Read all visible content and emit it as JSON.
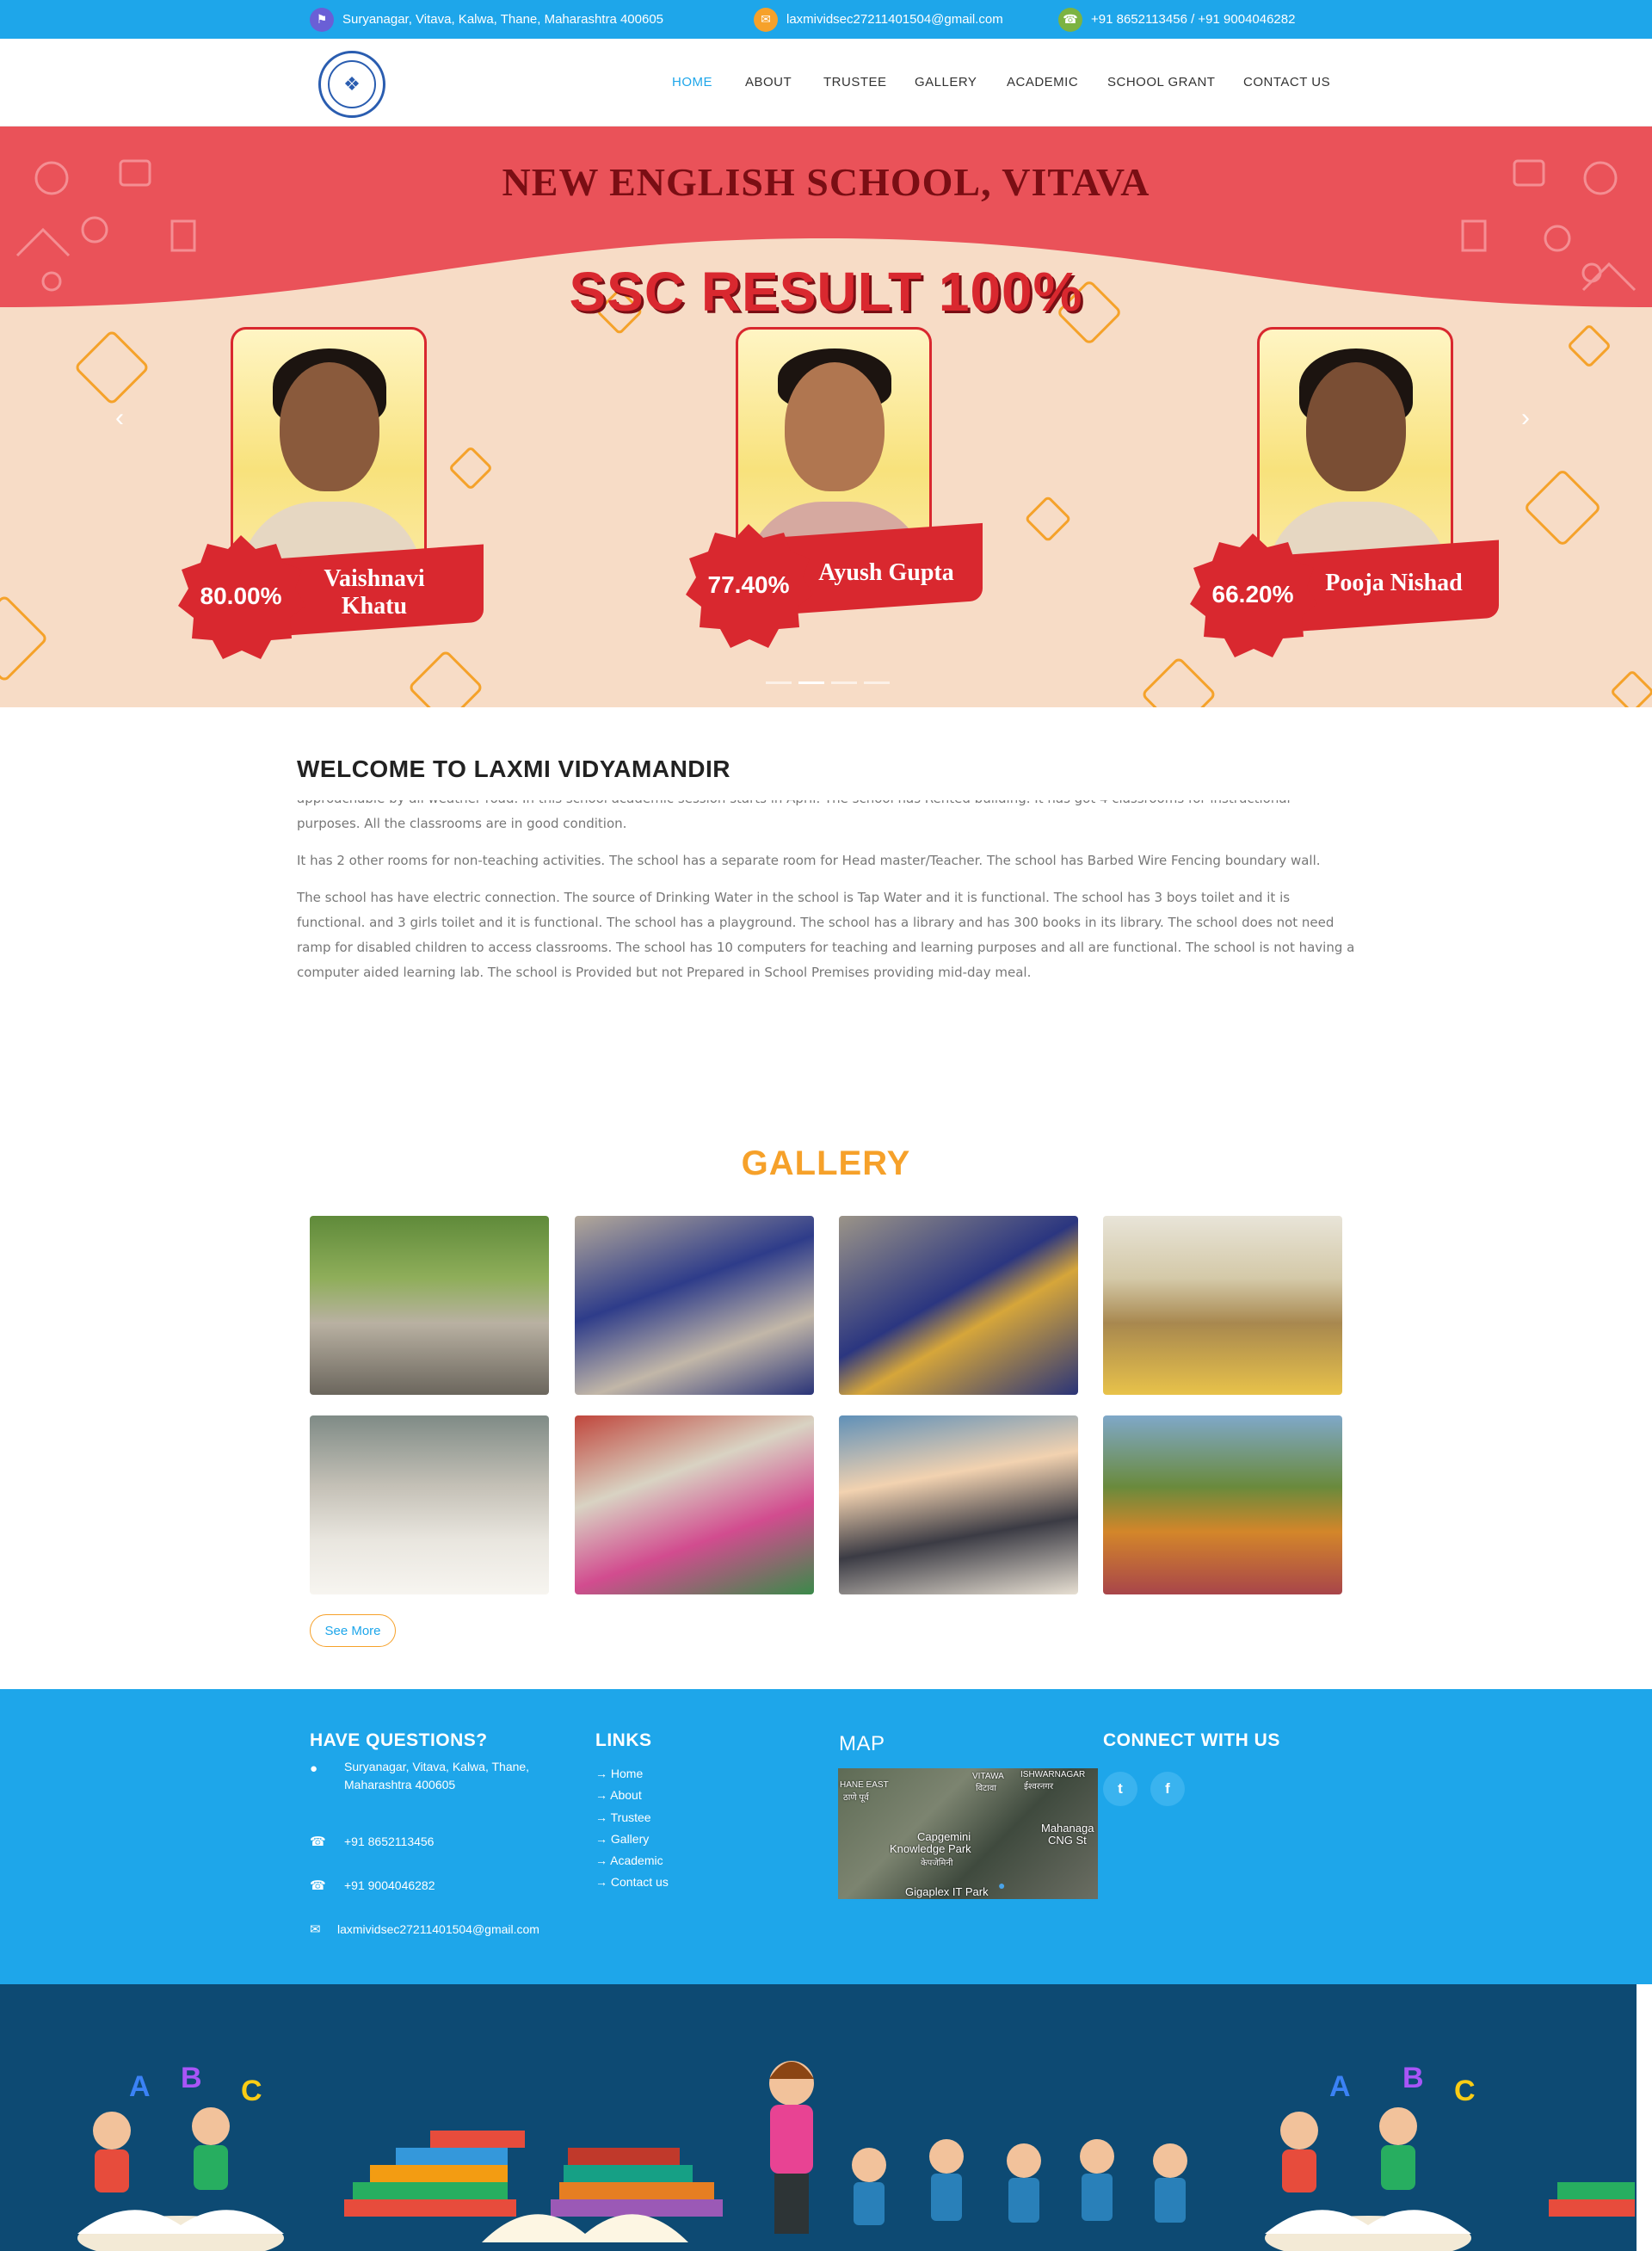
{
  "topbar": {
    "address": "Suryanagar, Vitava, Kalwa, Thane, Maharashtra 400605",
    "email": "laxmividsec27211401504@gmail.com",
    "phone": "+91 8652113456 / +91 9004046282",
    "icons": [
      "map-icon",
      "mail-icon",
      "phone-icon"
    ]
  },
  "nav": {
    "items": [
      "HOME",
      "ABOUT",
      "TRUSTEE",
      "GALLERY",
      "ACADEMIC",
      "SCHOOL GRANT",
      "CONTACT US"
    ],
    "active": "HOME"
  },
  "hero": {
    "title": "NEW ENGLISH SCHOOL, VITAVA",
    "result": "SSC RESULT 100%",
    "students": [
      {
        "percent": "80.00%",
        "name_line1": "Vaishnavi",
        "name_line2": "Khatu"
      },
      {
        "percent": "77.40%",
        "name_line1": "Ayush Gupta",
        "name_line2": ""
      },
      {
        "percent": "66.20%",
        "name_line1": "Pooja Nishad",
        "name_line2": ""
      }
    ],
    "slide_count": 4,
    "active_slide": 2
  },
  "welcome": {
    "title": "WELCOME TO LAXMI VIDYAMANDIR",
    "p1": "approachable by all weather road. In this school academic session starts in April. The school has Rented building. It has got 4 classrooms for instructional purposes. All the classrooms are in good condition.",
    "p2": "It has 2 other rooms for non-teaching activities. The school has a separate room for Head master/Teacher. The school has Barbed Wire Fencing boundary wall.",
    "p3": "The school has have electric connection. The source of Drinking Water in the school is Tap Water and it is functional. The school has 3 boys toilet and it is functional. and 3 girls toilet and it is functional. The school has a playground. The school has a library and has 300 books in its library. The school does not need ramp for disabled children to access classrooms. The school has 10 computers for teaching and learning purposes and all are functional. The school is not having a computer aided learning lab. The school is Provided but not Prepared in School Premises providing mid-day meal."
  },
  "gallery": {
    "title": "GALLERY",
    "see_more": "See More",
    "photo_count": 8
  },
  "footer": {
    "questions_title": "HAVE QUESTIONS?",
    "address_line1": "Suryanagar, Vitava, Kalwa, Thane,",
    "address_line2": "Maharashtra 400605",
    "phone1": "+91 8652113456",
    "phone2": "+91 9004046282",
    "email": "laxmividsec27211401504@gmail.com",
    "links_title": "LINKS",
    "links": [
      "Home",
      "About",
      "Trustee",
      "Gallery",
      "Academic",
      "Contact us"
    ],
    "map_title": "MAP",
    "map_labels": [
      "HANE EAST",
      "ठाणे पूर्व",
      "VITAWA",
      "विटावा",
      "ISHWARNAGAR",
      "ईश्वरनगर",
      "Capgemini",
      "Knowledge Park",
      "केपजेमिनी",
      "Mahanaga",
      "CNG St",
      "Gigaplex IT Park"
    ],
    "connect_title": "CONNECT WITH US",
    "social": [
      "twitter-icon",
      "facebook-icon"
    ]
  },
  "colors": {
    "primary_blue": "#1ea6ea",
    "accent_orange": "#f6a12a",
    "hero_red": "#d9282f",
    "hero_peach": "#f7dcc6",
    "footer_navy": "#0d4a73"
  }
}
